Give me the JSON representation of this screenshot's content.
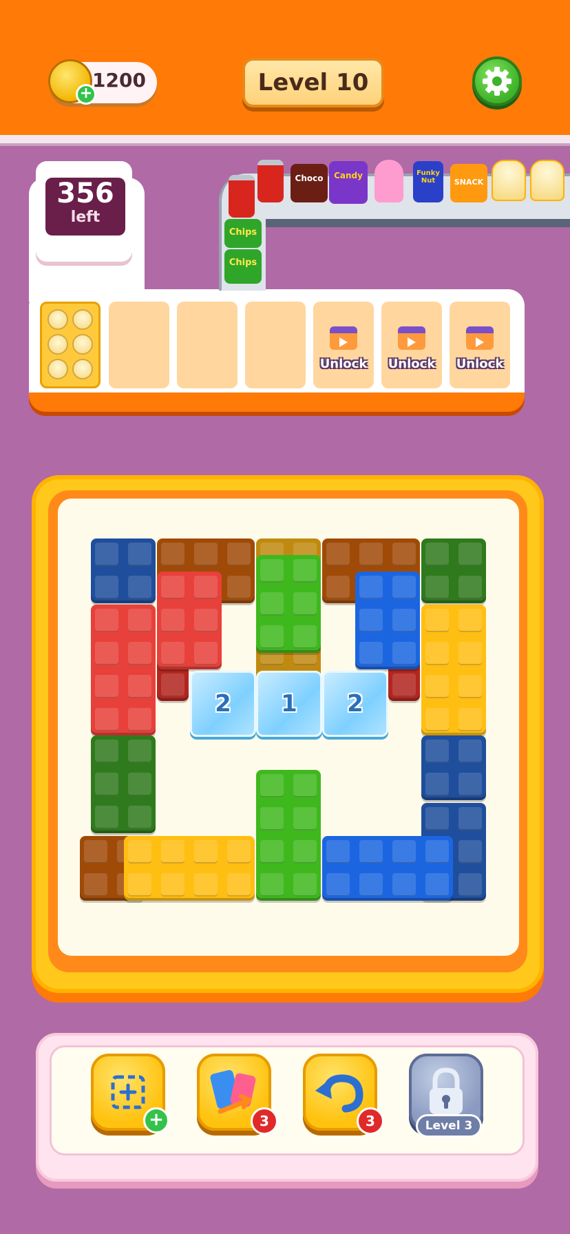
{
  "header": {
    "coins": "1200",
    "level_label": "Level 10",
    "settings_icon": "gear-icon"
  },
  "counter": {
    "number": "356",
    "label": "left"
  },
  "belt_items": [
    {
      "label": ""
    },
    {
      "label": "Choco"
    },
    {
      "label": "Candy"
    },
    {
      "label": ""
    },
    {
      "label": "Funky Nut"
    },
    {
      "label": "SNACK"
    },
    {
      "label": ""
    },
    {
      "label": ""
    },
    {
      "label": ""
    },
    {
      "label": "Chips"
    },
    {
      "label": "Chips"
    }
  ],
  "tray": {
    "unlock_label": "Unlock",
    "slots": [
      "filled",
      "empty",
      "empty",
      "empty",
      "locked",
      "locked",
      "locked"
    ]
  },
  "ice_blocks": [
    "2",
    "1",
    "2"
  ],
  "tools": [
    {
      "name": "add-slot",
      "badge": ""
    },
    {
      "name": "shuffle",
      "badge": "3"
    },
    {
      "name": "undo",
      "badge": "3"
    },
    {
      "name": "locked",
      "level_label": "Level 3"
    }
  ],
  "colors": {
    "header": "#ff7a06",
    "background": "#b06aa6",
    "accent_green": "#3fb12a",
    "board_frame": "#ffc81a"
  }
}
